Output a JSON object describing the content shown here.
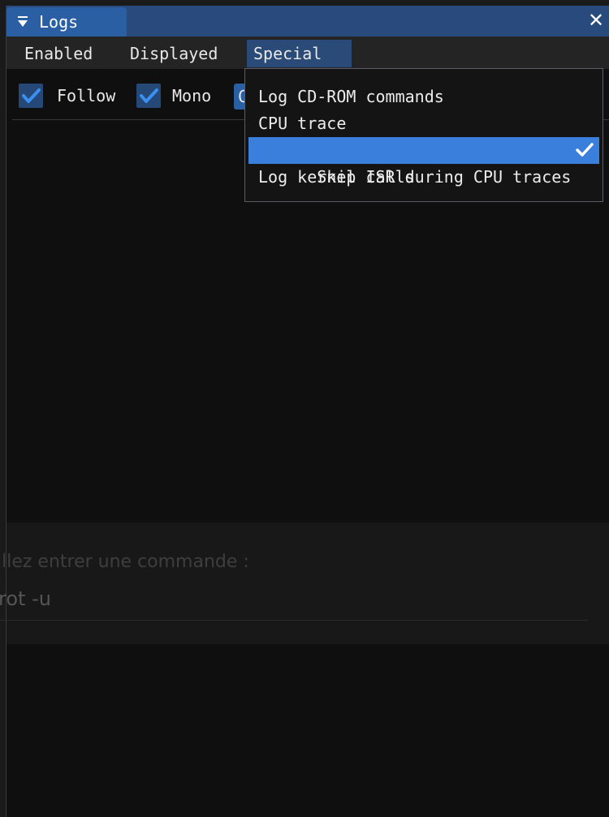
{
  "window": {
    "title": "Logs",
    "close_glyph": "✕",
    "icons": {
      "collapse": "collapse-triangle-icon",
      "close": "close-icon"
    }
  },
  "menubar": {
    "items": [
      {
        "label": "Enabled",
        "active": false
      },
      {
        "label": "Displayed",
        "active": false
      },
      {
        "label": "Special",
        "active": true
      }
    ]
  },
  "toolbar": {
    "follow": {
      "label": "Follow",
      "checked": true
    },
    "mono": {
      "label": "Mono",
      "checked": true
    },
    "partial_button_label": "C"
  },
  "special_menu": {
    "items": [
      {
        "label": "Log CD-ROM commands",
        "checked": false,
        "highlighted": false
      },
      {
        "label": "CPU trace",
        "checked": false,
        "highlighted": false
      },
      {
        "label": "Skip ISR during CPU traces",
        "checked": true,
        "highlighted": true
      },
      {
        "label": "Log kernel calls",
        "checked": false,
        "highlighted": false
      }
    ],
    "check_icon": "checkmark-icon"
  },
  "console_overlay": {
    "prompt": "illez entrer une commande :",
    "input_value": "rot -u"
  },
  "colors": {
    "title_bar": "#284a7c",
    "title_tab": "#2a5fa3",
    "menu_active": "#2a4a78",
    "highlight": "#3b7fdd",
    "checkbox": "#254876",
    "check": "#3b8ff0",
    "window_bg": "#0f0f0f"
  }
}
